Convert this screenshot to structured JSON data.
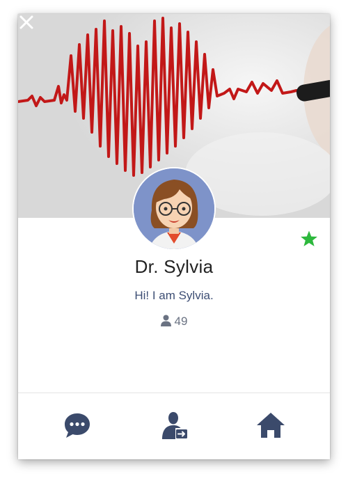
{
  "profile": {
    "name": "Dr. Sylvia",
    "status_message": "Hi! I am Sylvia.",
    "friend_count": "49",
    "favorite": true
  },
  "icons": {
    "close": "close-icon",
    "favorite": "star-icon",
    "friends": "person-icon",
    "chat": "chat-bubble-icon",
    "add_friend": "person-share-icon",
    "home": "home-icon"
  },
  "colors": {
    "star": "#2db83d",
    "action_icon": "#3b4a6b",
    "heartbeat": "#c21818",
    "avatar_bg": "#7e93c9"
  }
}
